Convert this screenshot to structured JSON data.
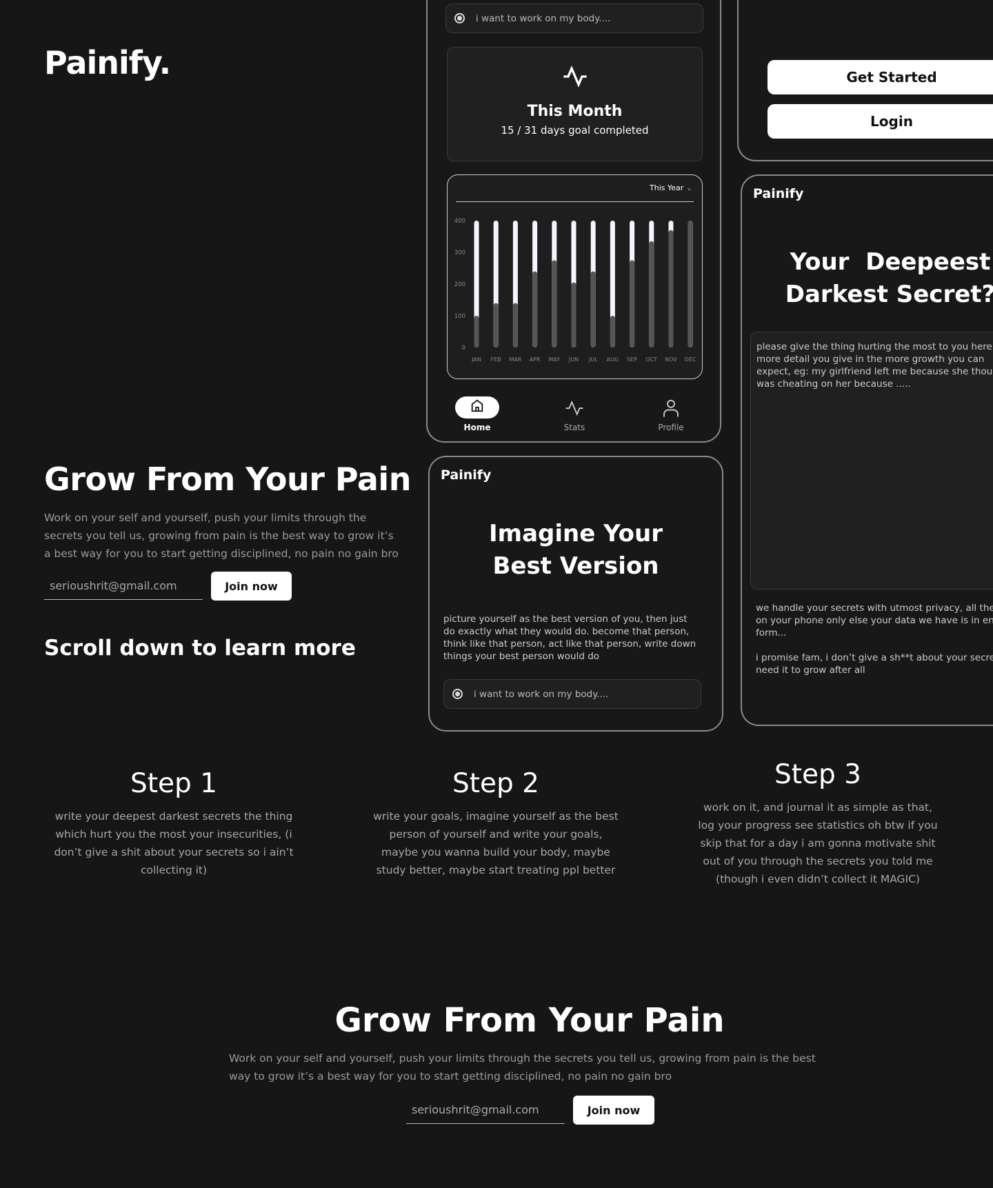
{
  "brand": "Painify.",
  "hero": {
    "title": "Grow From Your Pain",
    "text": "Work on your self and yourself, push your limits through the secrets you tell us, growing from pain is the best way to grow it’s a best way for you to start getting disciplined, no pain no gain bro",
    "email_value": "serioushrit@gmail.com",
    "join_label": "Join now"
  },
  "scroll_hint": "Scroll down to learn more",
  "phone1": {
    "goal_input": "i want to work on my body....",
    "month_title": "This Month",
    "month_sub": "15 / 31 days goal completed",
    "period_select": "This Year",
    "nav": [
      {
        "label": "Home",
        "icon": "home-icon",
        "active": true
      },
      {
        "label": "Stats",
        "icon": "activity-icon"
      },
      {
        "label": "Profile",
        "icon": "user-icon"
      }
    ]
  },
  "chart_data": {
    "type": "bar",
    "categories": [
      "JAN",
      "FEB",
      "MAR",
      "APR",
      "MAY",
      "JUN",
      "JUL",
      "AUG",
      "SEP",
      "OCT",
      "NOV",
      "DEC"
    ],
    "values": [
      100,
      140,
      140,
      240,
      275,
      205,
      240,
      100,
      275,
      335,
      370,
      400
    ],
    "ylim": [
      0,
      400
    ],
    "yticks": [
      0,
      100,
      200,
      300,
      400
    ],
    "grid": false
  },
  "phone2": {
    "brand": "Painify",
    "title": "Imagine Your Best Version",
    "text": "picture yourself as the best version of you, then just do exactly what they would do. become that person, think like that person, act like that person, write down things your best person would do",
    "goal_input": "i want to work on my body...."
  },
  "auth": {
    "get_started": "Get Started",
    "login": "Login"
  },
  "phone3": {
    "brand": "Painify",
    "title": "Your  Deepeest Darkest Secret?",
    "secret_text": "please give the thing hurting the most to you here, more detail you give in the more growth you can expect, eg: my girlfriend left me because she thought i was cheating on her because .....",
    "privacy": "we handle your secrets with utmost privacy, all the data is on your phone only else your data we have is in encrypted form...",
    "promise": "i promise fam, i don’t give a sh**t about your secret, you need it to grow after all"
  },
  "steps": [
    {
      "title": "Step 1",
      "text": "write your deepest darkest secrets the thing which hurt you the most your insecurities, (i don’t give a shit about your secrets so i ain’t collecting it)"
    },
    {
      "title": "Step 2",
      "text": "write your goals, imagine yourself as the best person of yourself and write your goals, maybe you wanna build your body, maybe study better, maybe start treating ppl better"
    },
    {
      "title": "Step 3",
      "text": "work on it, and journal it as simple as that, log your progress see statistics oh btw if you skip that for a day i am gonna motivate shit out of you through the secrets you told me (though i even didn’t collect it MAGIC)"
    }
  ],
  "footer_hero": {
    "title": "Grow From Your Pain",
    "text": "Work on your self and yourself, push your limits through the secrets you tell us, growing from pain is the best way to grow it’s a best way for you to start getting disciplined, no pain no gain bro",
    "email_value": "serioushrit@gmail.com",
    "join_label": "Join now"
  }
}
